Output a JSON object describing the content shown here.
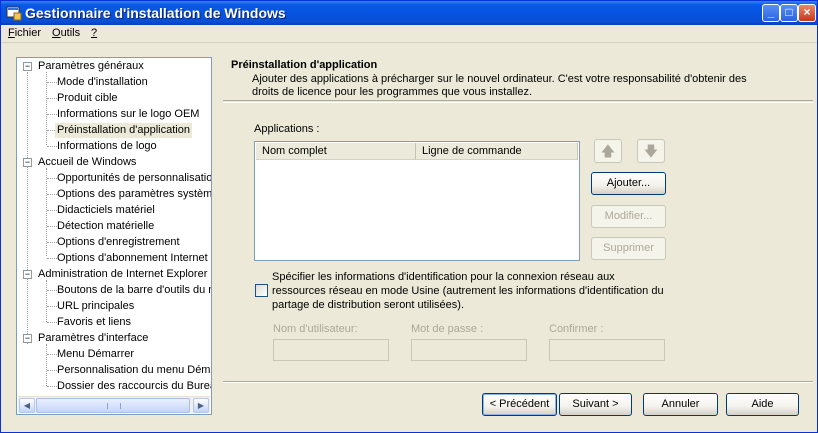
{
  "window": {
    "title": "Gestionnaire d'installation de Windows"
  },
  "menu": [
    {
      "label": "Fichier",
      "mnemonic": "F",
      "rest": "ichier"
    },
    {
      "label": "Outils",
      "mnemonic": "O",
      "rest": "utils"
    },
    {
      "label": "?",
      "mnemonic": "?",
      "rest": ""
    }
  ],
  "tree": {
    "groups": [
      {
        "label": "Paramètres généraux",
        "items": [
          "Mode d'installation",
          "Produit cible",
          "Informations sur le logo OEM",
          "Préinstallation d'application",
          "Informations de logo"
        ]
      },
      {
        "label": "Accueil de Windows",
        "items": [
          "Opportunités de personnalisation",
          "Options des paramètres système",
          "Didacticiels matériel",
          "Détection matérielle",
          "Options d'enregistrement",
          "Options d'abonnement Internet"
        ]
      },
      {
        "label": "Administration de Internet Explorer",
        "items": [
          "Boutons de la barre d'outils du navigateur",
          "URL principales",
          "Favoris et liens"
        ]
      },
      {
        "label": "Paramètres d'interface",
        "items": [
          "Menu Démarrer",
          "Personnalisation du menu Démarrer",
          "Dossier des raccourcis du Bureau"
        ]
      }
    ],
    "selected": "Préinstallation d'application"
  },
  "header": {
    "title": "Préinstallation d'application",
    "description": "Ajouter des applications à précharger sur le nouvel ordinateur. C'est votre responsabilité d'obtenir des droits de licence pour les programmes que vous installez."
  },
  "applications": {
    "label": "Applications :",
    "columns": [
      "Nom complet",
      "Ligne de commande"
    ],
    "rows": []
  },
  "side_buttons": {
    "add": "Ajouter...",
    "modify": "Modifier...",
    "delete": "Supprimer"
  },
  "credentials": {
    "checkbox_text": "Spécifier les informations d'identification pour la connexion réseau aux ressources réseau en mode Usine (autrement les informations d'identification du partage de distribution seront utilisées).",
    "checked": false,
    "username_label": "Nom d'utilisateur:",
    "password_label": "Mot de passe :",
    "confirm_label": "Confirmer :",
    "username_value": "",
    "password_value": "",
    "confirm_value": ""
  },
  "footer": {
    "back": "< Précédent",
    "next": "Suivant >",
    "cancel": "Annuler",
    "help": "Aide"
  },
  "colors": {
    "titlebar": "#0553e0",
    "window_bg": "#ece9d8",
    "disabled_text": "#aca899"
  },
  "icons": {
    "app": "window-setup-icon",
    "up": "arrow-up-icon",
    "down": "arrow-down-icon"
  }
}
